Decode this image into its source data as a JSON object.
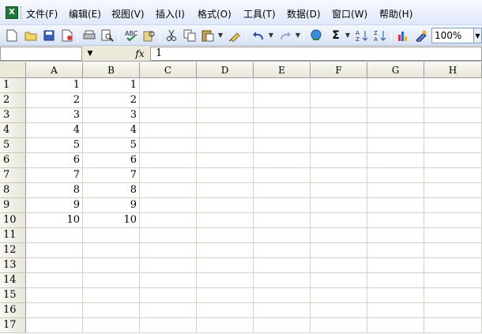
{
  "menu": {
    "app_icon": "excel-icon",
    "items": [
      "文件(F)",
      "编辑(E)",
      "视图(V)",
      "插入(I)",
      "格式(O)",
      "工具(T)",
      "数据(D)",
      "窗口(W)",
      "帮助(H)"
    ]
  },
  "toolbar": {
    "zoom": "100%",
    "icons": [
      "new-icon",
      "open-icon",
      "save-icon",
      "permission-icon",
      "print-icon",
      "print-preview-icon",
      "spelling-icon",
      "research-icon",
      "cut-icon",
      "copy-icon",
      "paste-icon",
      "format-painter-icon",
      "undo-icon",
      "redo-icon",
      "hyperlink-icon",
      "autosum-icon",
      "sort-ascending-icon",
      "sort-descending-icon",
      "chart-wizard-icon",
      "drawing-icon"
    ]
  },
  "formula_bar": {
    "name_box": "",
    "fx": "fx",
    "value": "1"
  },
  "sheet": {
    "columns": [
      "A",
      "B",
      "C",
      "D",
      "E",
      "F",
      "G",
      "H"
    ],
    "rows": [
      {
        "num": "1",
        "A": "1",
        "B": "1"
      },
      {
        "num": "2",
        "A": "2",
        "B": "2"
      },
      {
        "num": "3",
        "A": "3",
        "B": "3"
      },
      {
        "num": "4",
        "A": "4",
        "B": "4"
      },
      {
        "num": "5",
        "A": "5",
        "B": "5"
      },
      {
        "num": "6",
        "A": "6",
        "B": "6"
      },
      {
        "num": "7",
        "A": "7",
        "B": "7"
      },
      {
        "num": "8",
        "A": "8",
        "B": "8"
      },
      {
        "num": "9",
        "A": "9",
        "B": "9"
      },
      {
        "num": "10",
        "A": "10",
        "B": "10"
      },
      {
        "num": "11",
        "A": "",
        "B": ""
      },
      {
        "num": "12",
        "A": "",
        "B": ""
      },
      {
        "num": "13",
        "A": "",
        "B": ""
      },
      {
        "num": "14",
        "A": "",
        "B": ""
      },
      {
        "num": "15",
        "A": "",
        "B": ""
      },
      {
        "num": "16",
        "A": "",
        "B": ""
      },
      {
        "num": "17",
        "A": "",
        "B": ""
      }
    ]
  },
  "colors": {
    "header_bg": "#ece9d8",
    "gridline": "#d4d0c8",
    "toolbar_bg": "#dfe8f8"
  }
}
